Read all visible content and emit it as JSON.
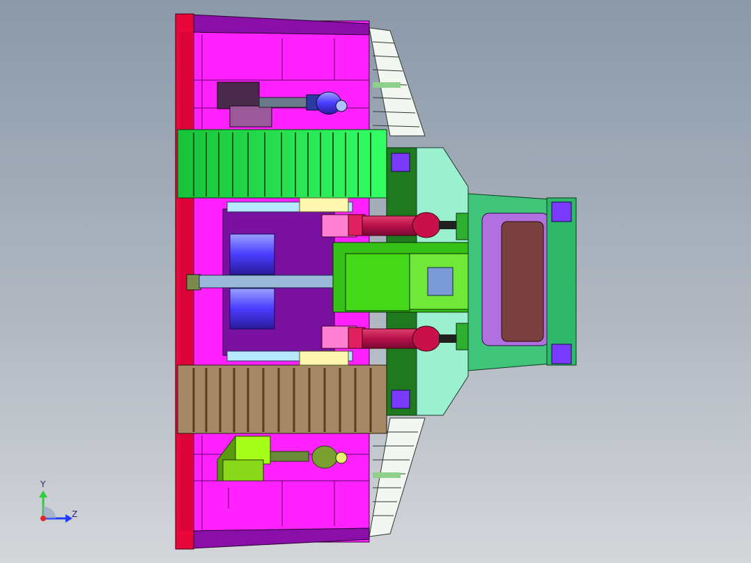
{
  "view": {
    "axis_triad": {
      "y_label": "Y",
      "z_label": "Z",
      "colors": {
        "y": "#2ecc40",
        "z": "#1f3cff",
        "origin": "#e5242b"
      }
    }
  },
  "colors": {
    "background_top": "#8b99aa",
    "background_bottom": "#d4d6da",
    "frame_magenta": "#ff22ff",
    "frame_purple": "#8a0fa8",
    "bar_red": "#e8073a",
    "gear_green": "#2ef05c",
    "gear_brown": "#a58866",
    "mount_green": "#36c018",
    "cap_lightgreen": "#9bf0b8",
    "cylinder_red": "#c8104a",
    "cab_green": "#3fc47a",
    "cab_window": "#7a4040"
  }
}
